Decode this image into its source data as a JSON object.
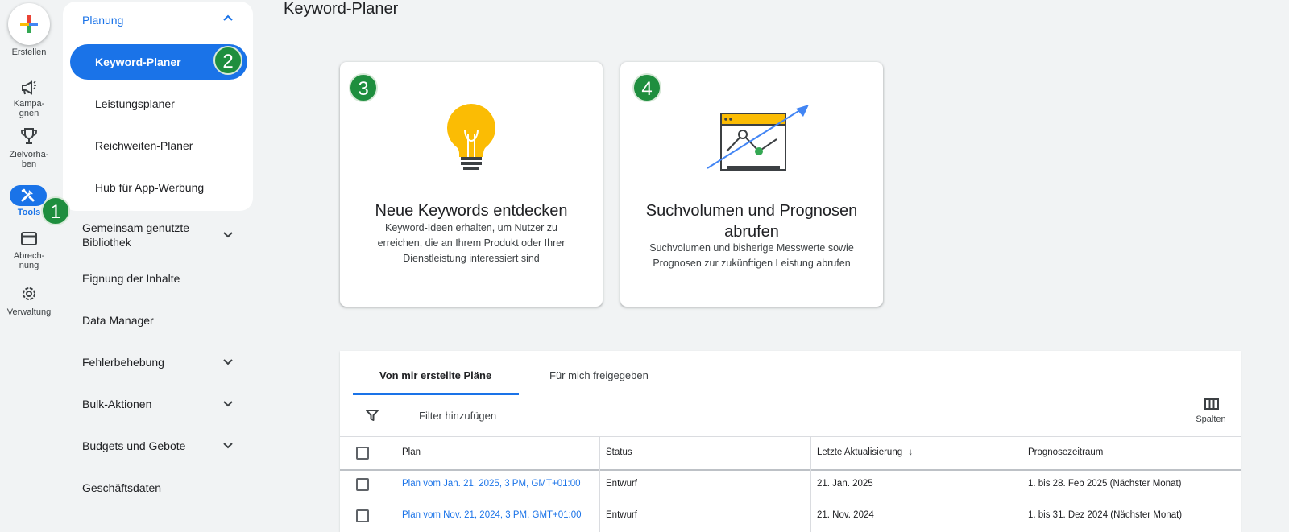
{
  "rail": {
    "create_label": "Erstellen",
    "items": [
      {
        "label_1": "Kampa-",
        "label_2": "gnen"
      },
      {
        "label_1": "Zielvorha-",
        "label_2": "ben"
      },
      {
        "label_1": "Tools"
      },
      {
        "label_1": "Abrech-",
        "label_2": "nung"
      },
      {
        "label_1": "Verwaltung"
      }
    ]
  },
  "menu": {
    "section_title": "Planung",
    "active_item": "Keyword-Planer",
    "sub_items": [
      "Leistungsplaner",
      "Reichweiten-Planer",
      "Hub für App-Werbung"
    ],
    "nav_items": [
      {
        "label_1": "Gemeinsam genutzte",
        "label_2": "Bibliothek"
      },
      {
        "label_1": "Eignung der Inhalte"
      },
      {
        "label_1": "Data Manager"
      },
      {
        "label_1": "Fehlerbehebung"
      },
      {
        "label_1": "Bulk-Aktionen"
      },
      {
        "label_1": "Budgets und Gebote"
      },
      {
        "label_1": "Geschäftsdaten"
      }
    ]
  },
  "badges": [
    "1",
    "2",
    "3",
    "4"
  ],
  "page_title": "Keyword-Planer",
  "cards": [
    {
      "title": "Neue Keywords entdecken",
      "desc": "Keyword-Ideen erhalten, um Nutzer zu erreichen, die an Ihrem Produkt oder Ihrer Dienstleistung interessiert sind",
      "icon": "lightbulb-icon"
    },
    {
      "title": "Suchvolumen und Prognosen abrufen",
      "desc": "Suchvolumen und bisherige Messwerte sowie Prognosen zur zukünftigen Leistung abrufen",
      "icon": "forecast-chart-icon"
    }
  ],
  "table": {
    "tabs": [
      "Von mir erstellte Pläne",
      "Für mich freigegeben"
    ],
    "filter_placeholder": "Filter hinzufügen",
    "columns_label": "Spalten",
    "headers": [
      "Plan",
      "Status",
      "Letzte Aktualisierung",
      "Prognosezeitraum"
    ],
    "rows": [
      {
        "plan": "Plan vom Jan. 21, 2025, 3 PM, GMT+01:00",
        "status": "Entwurf",
        "updated": "21. Jan. 2025",
        "period": "1. bis 28. Feb 2025 (Nächster Monat)"
      },
      {
        "plan": "Plan vom Nov. 21, 2024, 3 PM, GMT+01:00",
        "status": "Entwurf",
        "updated": "21. Nov. 2024",
        "period": "1. bis 31. Dez 2024 (Nächster Monat)"
      }
    ]
  },
  "colors": {
    "accent": "#1a73e8",
    "badge": "#1e8e3e",
    "bulb": "#fbbc04"
  }
}
